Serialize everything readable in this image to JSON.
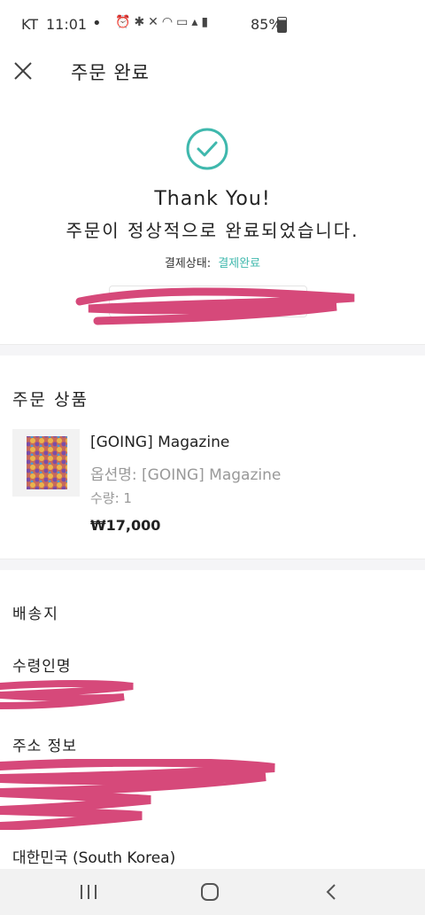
{
  "status_bar": {
    "carrier": "KT",
    "time": "11:01",
    "dot": "•",
    "battery": "85%"
  },
  "header": {
    "title": "주문 완료"
  },
  "confirmation": {
    "thank_you": "Thank You!",
    "message": "주문이 정상적으로 완료되었습니다.",
    "payment_status_label": "결제상태:",
    "payment_status_value": "결제완료",
    "accent_color": "#3fb8ad"
  },
  "order_items": {
    "section_title": "주문 상품",
    "items": [
      {
        "name": "[GOING] Magazine",
        "option": "옵션명: [GOING] Magazine",
        "quantity": "수량: 1",
        "price": "₩17,000"
      }
    ]
  },
  "shipping": {
    "section_title": "배송지",
    "recipient_label": "수령인명",
    "address_label": "주소 정보",
    "country": "대한민국 (South Korea)"
  },
  "redaction_color": "#d6497a"
}
